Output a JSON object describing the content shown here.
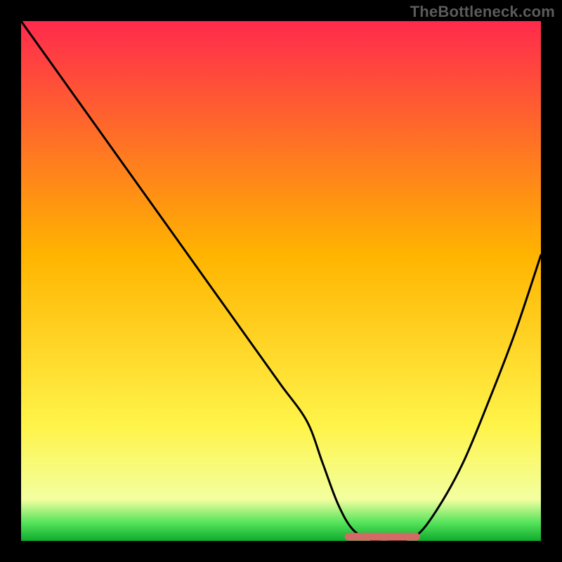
{
  "watermark": "TheBottleneck.com",
  "colors": {
    "background": "#000000",
    "gradient_top": "#ff2a4d",
    "gradient_mid": "#ffd400",
    "gradient_low": "#f8ff66",
    "gradient_green": "#2bdc4a",
    "curve": "#000000",
    "flat_segment": "#d46a66",
    "watermark": "#5b5b5b"
  },
  "chart_data": {
    "type": "line",
    "title": "",
    "xlabel": "",
    "ylabel": "",
    "xlim": [
      0,
      100
    ],
    "ylim": [
      0,
      100
    ],
    "x": [
      0,
      5,
      10,
      15,
      20,
      25,
      30,
      35,
      40,
      45,
      50,
      55,
      58,
      61,
      64,
      68,
      72,
      76,
      80,
      85,
      90,
      95,
      100
    ],
    "values": [
      100,
      93,
      86,
      79,
      72,
      65,
      58,
      51,
      44,
      37,
      30,
      23,
      15,
      7,
      2,
      0,
      0,
      1,
      6,
      15,
      27,
      40,
      55
    ],
    "flat_segment": {
      "x_start": 63,
      "x_end": 76,
      "y": 0
    },
    "gradient_stops": [
      {
        "offset": 0.0,
        "color": "#ff2a4d"
      },
      {
        "offset": 0.45,
        "color": "#ffb400"
      },
      {
        "offset": 0.78,
        "color": "#fff44a"
      },
      {
        "offset": 0.92,
        "color": "#f3ffa0"
      },
      {
        "offset": 0.965,
        "color": "#55e35b"
      },
      {
        "offset": 1.0,
        "color": "#0faa2d"
      }
    ]
  }
}
